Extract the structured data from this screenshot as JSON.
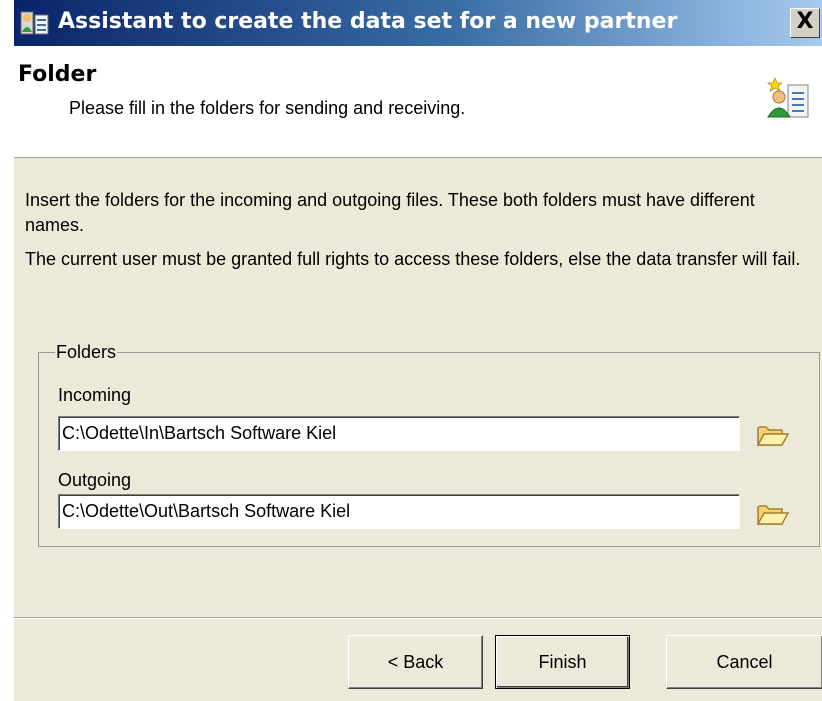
{
  "window": {
    "title": "Assistant to create the data set for a new partner",
    "close_label": "X"
  },
  "header": {
    "title": "Folder",
    "subtitle": "Please fill in the folders for sending and receiving.",
    "icon": "new-partner-icon"
  },
  "body": {
    "paragraph1": "Insert the folders for the incoming and outgoing files. These both folders must have different names.",
    "paragraph2": "The current user must be granted full rights to access these folders, else the data transfer will fail."
  },
  "folders": {
    "group_label": "Folders",
    "incoming": {
      "label": "Incoming",
      "value": "C:\\Odette\\In\\Bartsch Software Kiel",
      "browse_icon": "folder-open-icon"
    },
    "outgoing": {
      "label": "Outgoing",
      "value": "C:\\Odette\\Out\\Bartsch Software Kiel",
      "browse_icon": "folder-open-icon"
    }
  },
  "buttons": {
    "back": "< Back",
    "finish": "Finish",
    "cancel": "Cancel"
  },
  "colors": {
    "title_bar": "#0a246a",
    "dialog_face": "#ece9d8",
    "header_background": "#ffffff"
  }
}
